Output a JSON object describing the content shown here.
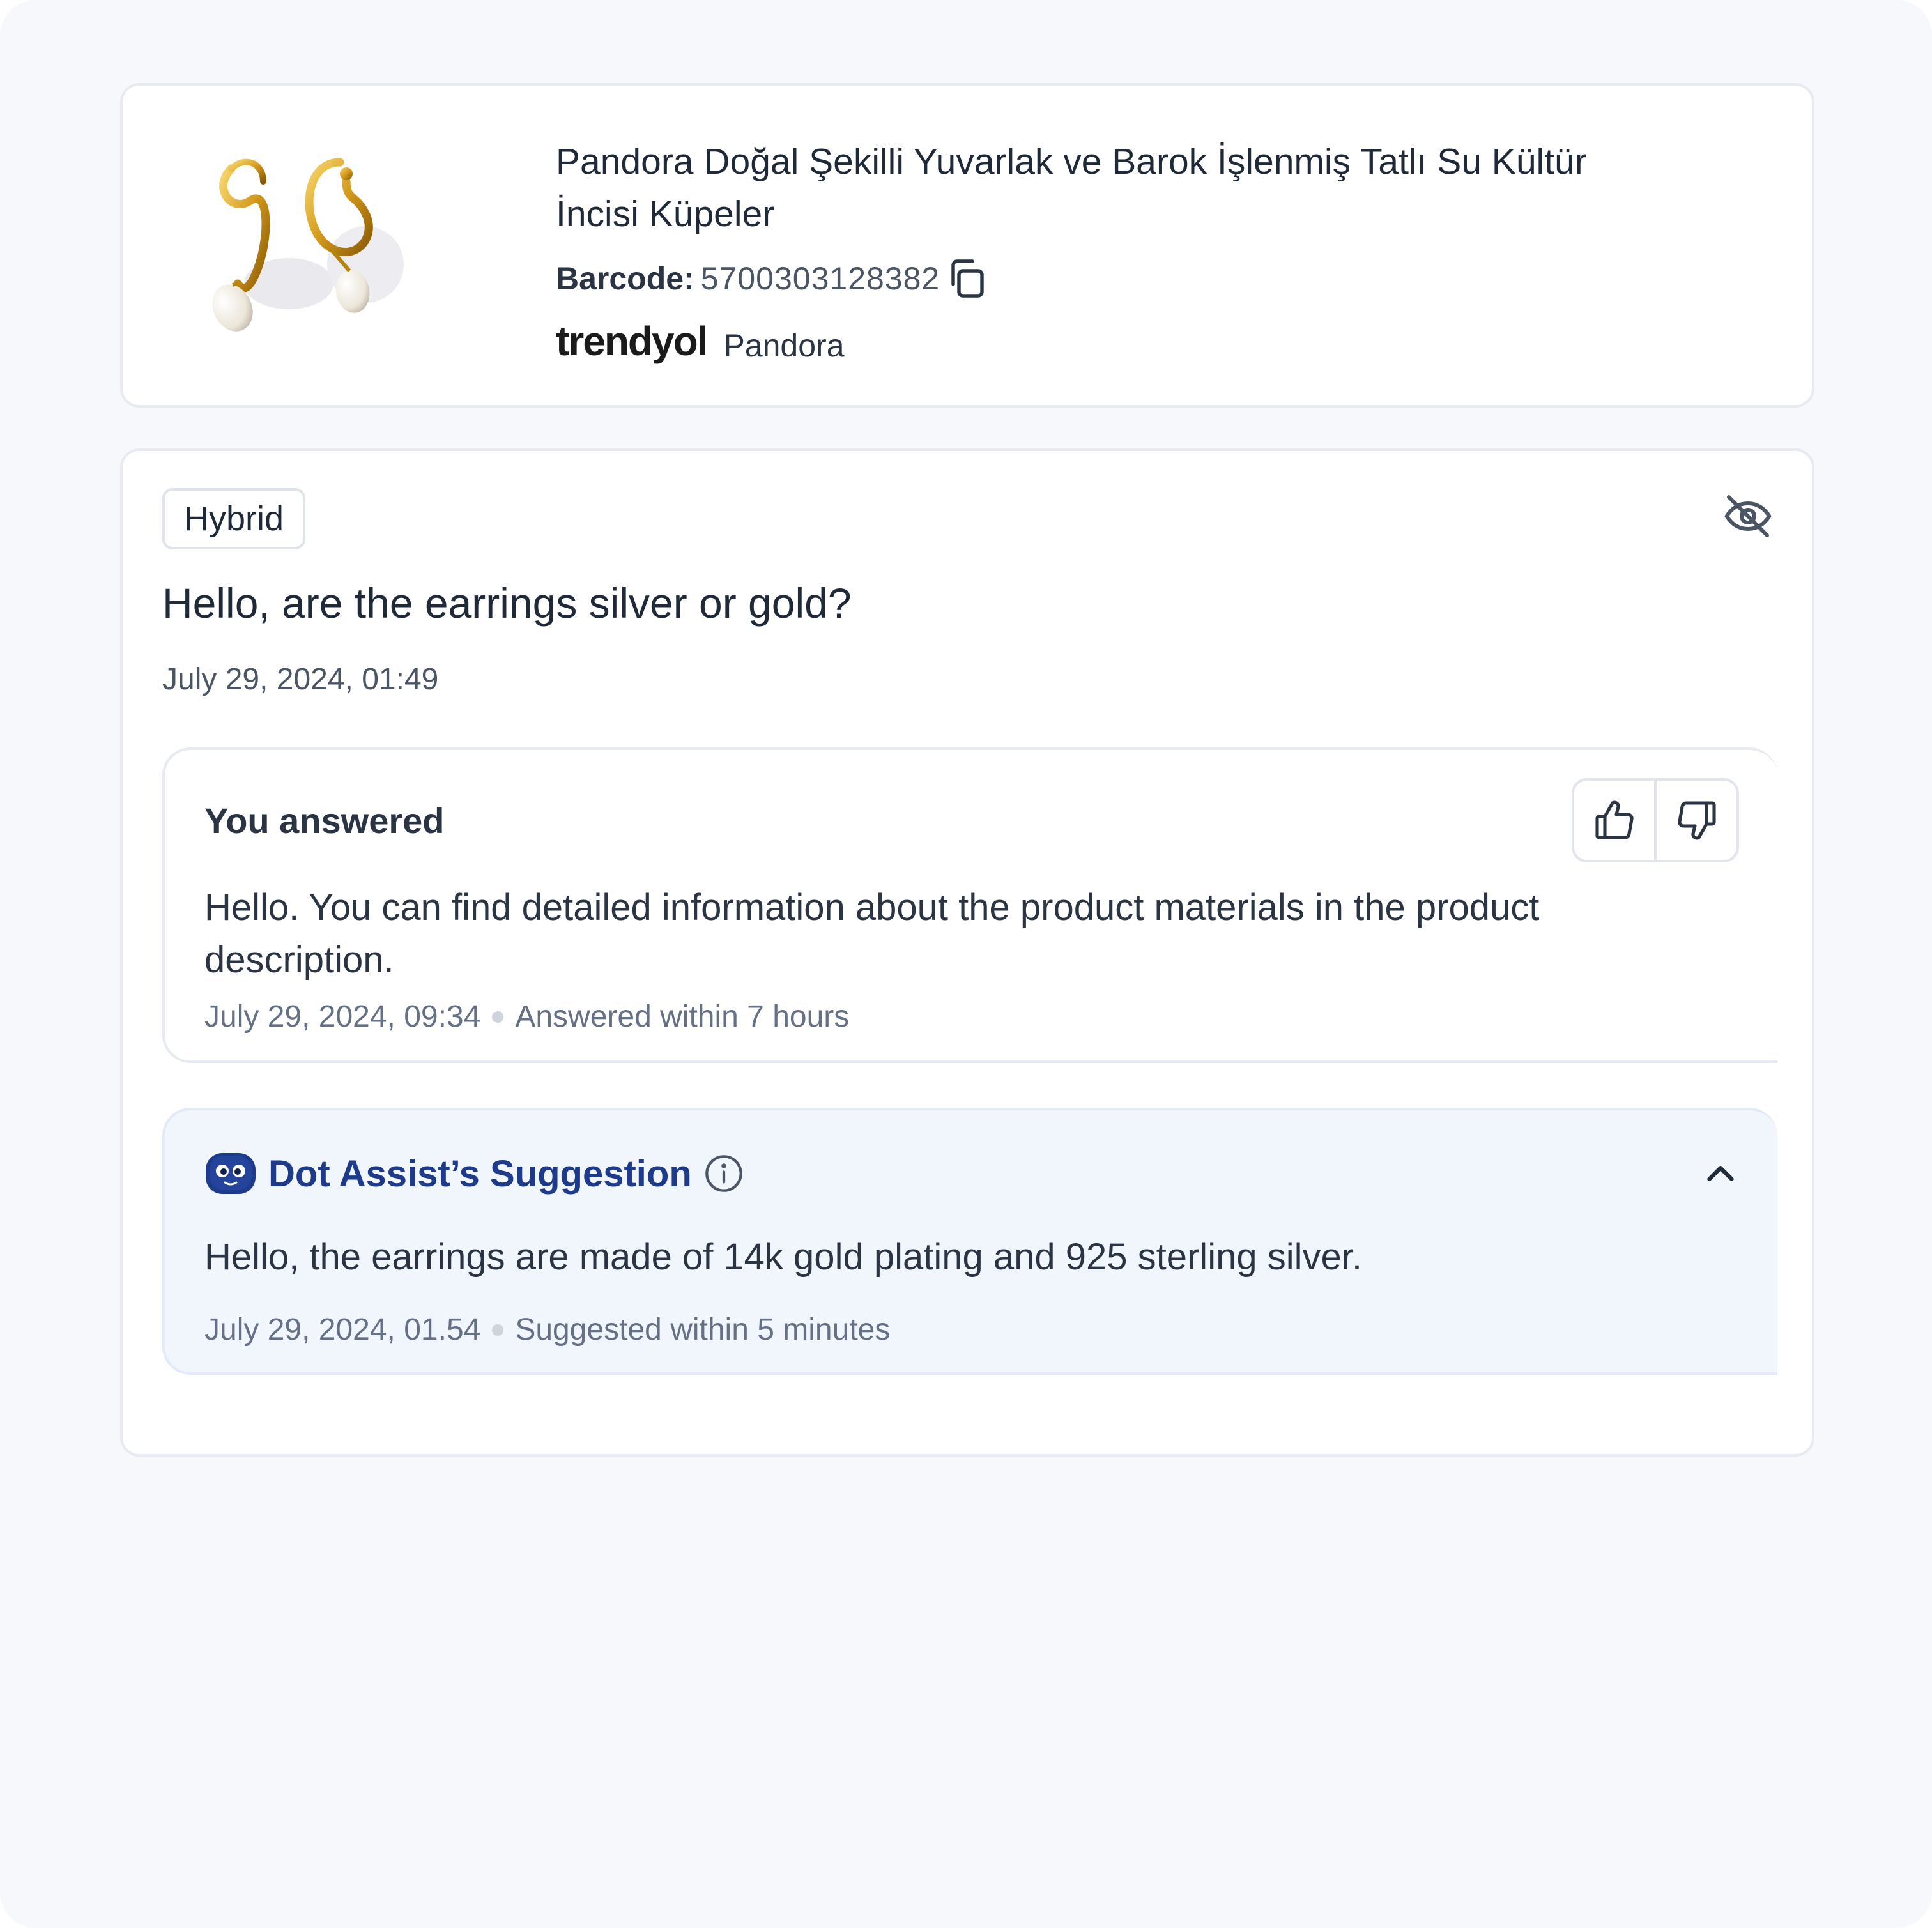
{
  "product": {
    "title": "Pandora Doğal Şekilli Yuvarlak ve Barok İşlenmiş Tatlı Su Kültür İncisi Küpeler",
    "barcode_label": "Barcode:",
    "barcode_value": "5700303128382",
    "store_logo": "trendyol",
    "brand": "Pandora",
    "image_icon": "earrings-product-image"
  },
  "question": {
    "tag": "Hybrid",
    "text": "Hello, are the earrings silver or gold?",
    "date": "July 29, 2024, 01:49",
    "hide_icon": "eye-off-icon"
  },
  "answer": {
    "heading": "You answered",
    "text": "Hello. You can find detailed information about the product materials in the product description.",
    "date": "July 29, 2024, 09:34",
    "duration": "Answered within 7 hours"
  },
  "suggestion": {
    "title": "Dot Assist’s Suggestion",
    "text": "Hello, the earrings are made of 14k gold plating and 925 sterling silver.",
    "date": "July 29, 2024, 01.54",
    "duration": "Suggested within 5 minutes",
    "expanded": true
  },
  "colors": {
    "page_bg": "#f7f8fb",
    "card_bg": "#ffffff",
    "suggestion_bg": "#f1f6fd",
    "suggestion_title": "#1e3a8a",
    "text_primary": "#1f2937",
    "text_muted": "#667085"
  }
}
